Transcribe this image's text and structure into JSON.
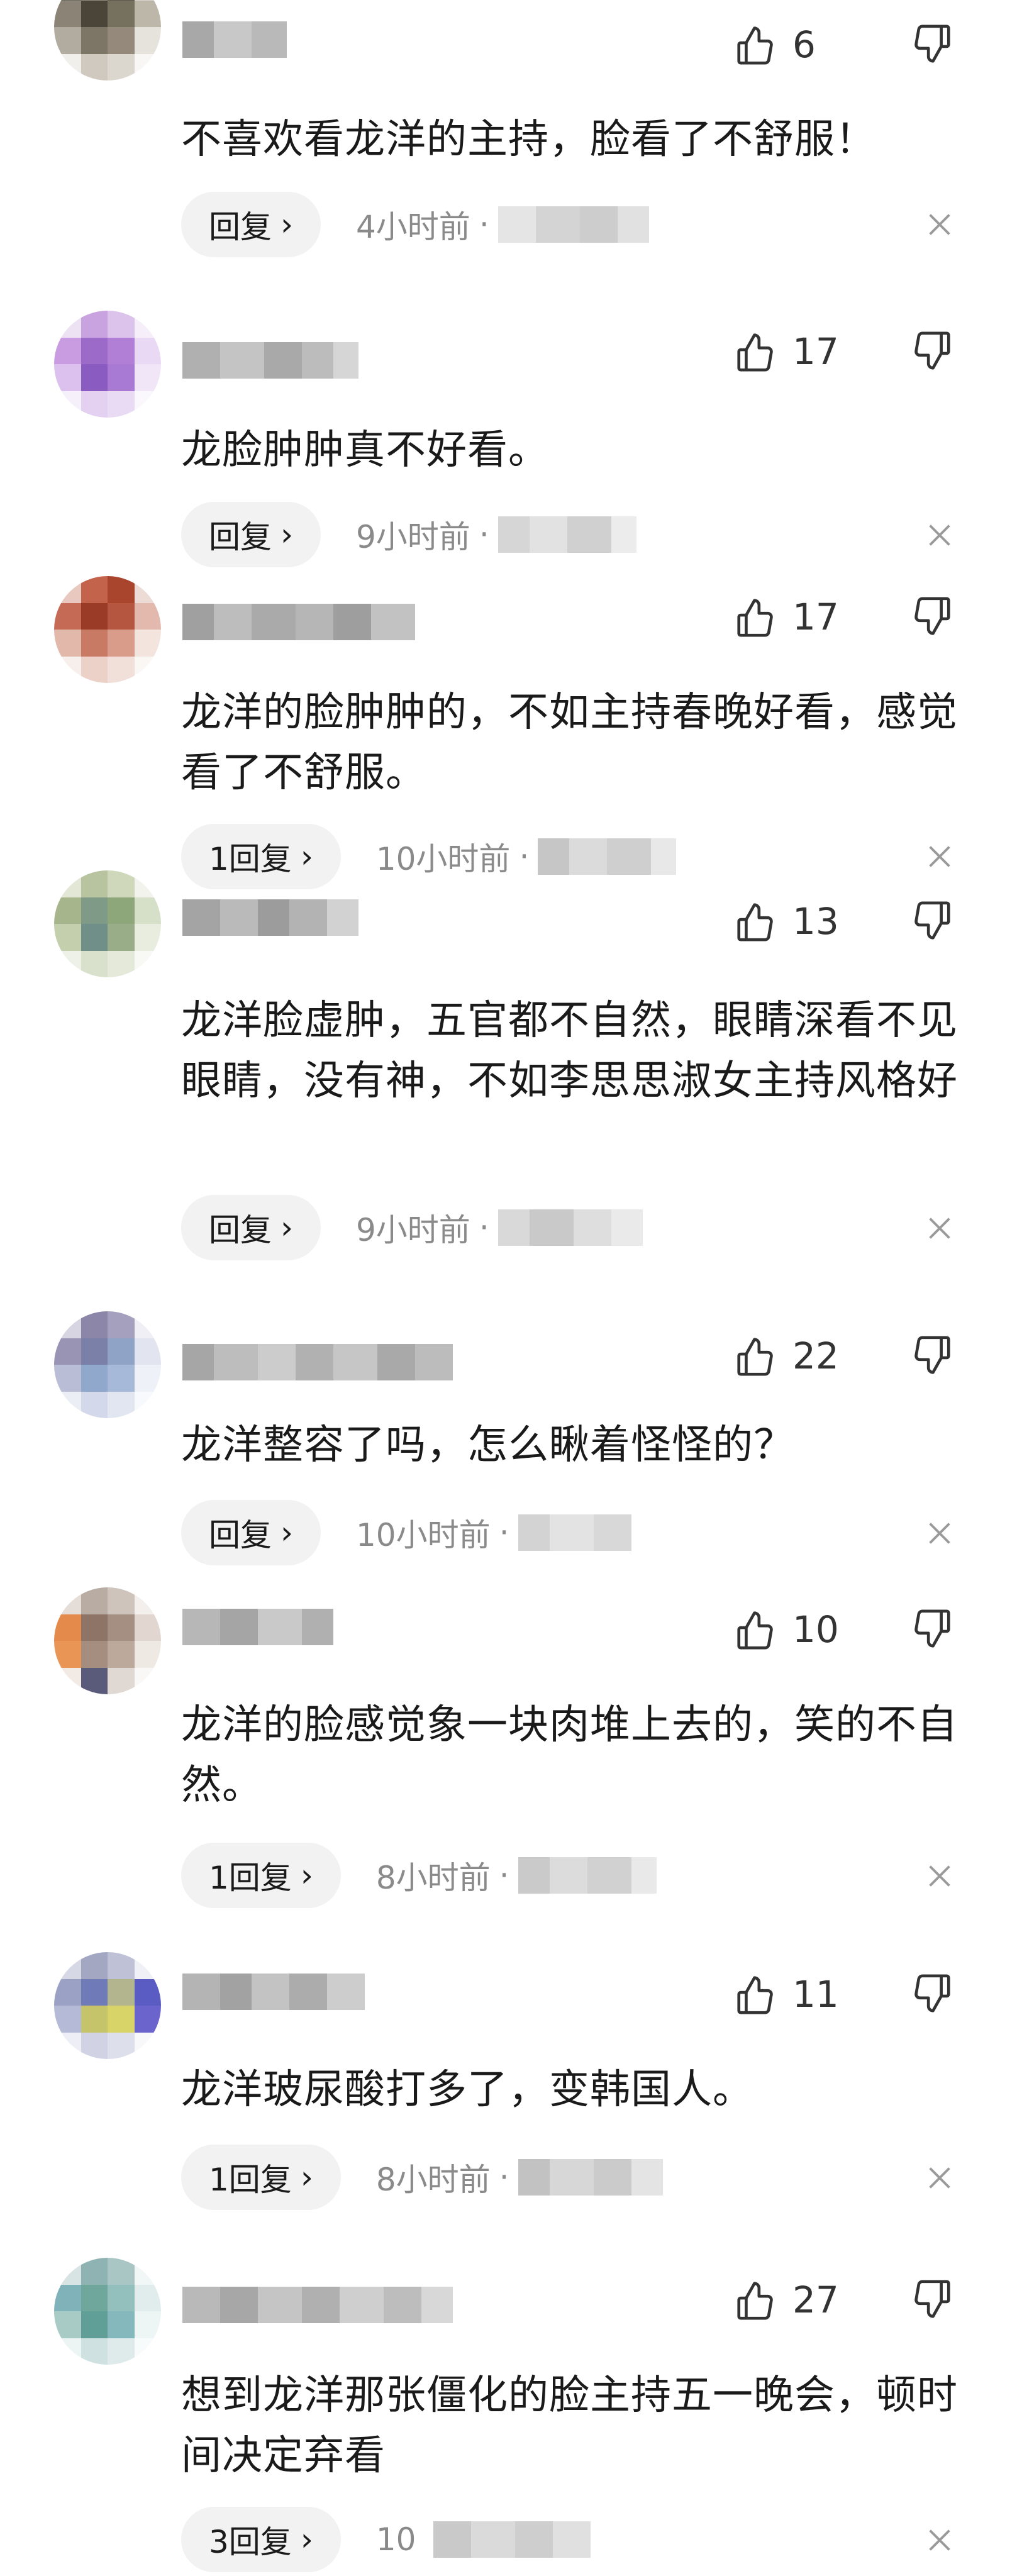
{
  "colors": {
    "text": "#1a1a1a",
    "meta": "#8a8a8a",
    "pill_bg": "#f2f2f2",
    "icon": "#333333"
  },
  "icons": {
    "like": "thumbs-up-outline",
    "dislike": "thumbs-down-outline",
    "close": "x-mark"
  },
  "comments": [
    {
      "username": "",
      "likes": "6",
      "text": "不喜欢看龙洋的主持，脸看了不舒服！",
      "reply": "回复",
      "time": "4小时前",
      "dot": "·"
    },
    {
      "username": "",
      "likes": "17",
      "text": "龙脸肿肿真不好看。",
      "reply": "回复",
      "time": "9小时前",
      "dot": "·"
    },
    {
      "username": "",
      "likes": "17",
      "text": "龙洋的脸肿肿的，不如主持春晚好看，感觉看了不舒服。",
      "reply": "1回复",
      "time": "10小时前",
      "dot": "·"
    },
    {
      "username": "",
      "likes": "13",
      "text": "龙洋脸虚肿，五官都不自然，眼睛深看不见眼睛，没有神，不如李思思淑女主持风格好",
      "reply": "回复",
      "time": "9小时前",
      "dot": "·"
    },
    {
      "username": "",
      "likes": "22",
      "text": "龙洋整容了吗，怎么瞅着怪怪的？",
      "reply": "回复",
      "time": "10小时前",
      "dot": "·"
    },
    {
      "username": "",
      "likes": "10",
      "text": "龙洋的脸感觉象一块肉堆上去的，笑的不自然。",
      "reply": "1回复",
      "time": "8小时前",
      "dot": "·"
    },
    {
      "username": "",
      "likes": "11",
      "text": "龙洋玻尿酸打多了，变韩国人。",
      "reply": "1回复",
      "time": "8小时前",
      "dot": "·"
    },
    {
      "username": "",
      "likes": "27",
      "text": "想到龙洋那张僵化的脸主持五一晚会，顿时间决定弃看",
      "reply": "3回复",
      "time": "10",
      "dot": ""
    }
  ]
}
